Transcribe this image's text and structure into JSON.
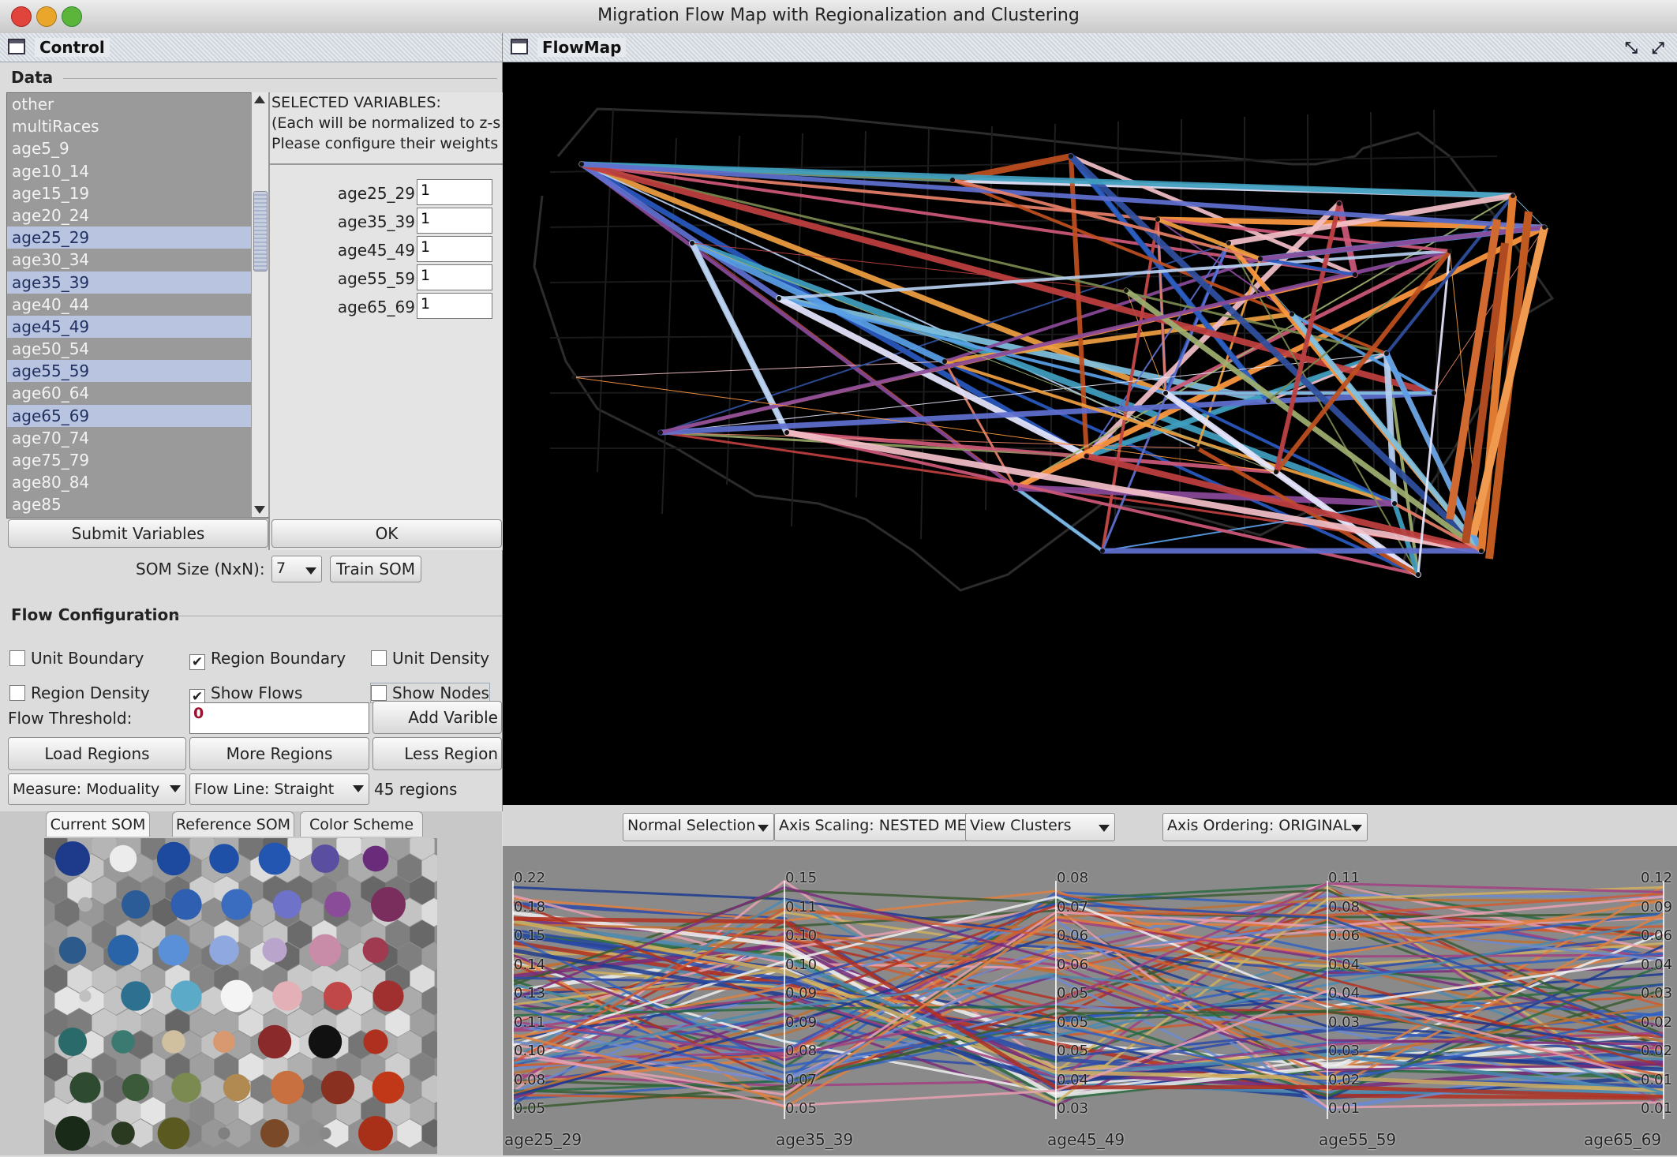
{
  "window": {
    "title": "Migration Flow Map with Regionalization and Clustering"
  },
  "control": {
    "title": "Control",
    "data_group": "Data",
    "variables": [
      {
        "label": "other",
        "selected": false
      },
      {
        "label": "multiRaces",
        "selected": false
      },
      {
        "label": "age5_9",
        "selected": false
      },
      {
        "label": "age10_14",
        "selected": false
      },
      {
        "label": "age15_19",
        "selected": false
      },
      {
        "label": "age20_24",
        "selected": false
      },
      {
        "label": "age25_29",
        "selected": true
      },
      {
        "label": "age30_34",
        "selected": false
      },
      {
        "label": "age35_39",
        "selected": true
      },
      {
        "label": "age40_44",
        "selected": false
      },
      {
        "label": "age45_49",
        "selected": true
      },
      {
        "label": "age50_54",
        "selected": false
      },
      {
        "label": "age55_59",
        "selected": true
      },
      {
        "label": "age60_64",
        "selected": false
      },
      {
        "label": "age65_69",
        "selected": true
      },
      {
        "label": "age70_74",
        "selected": false
      },
      {
        "label": "age75_79",
        "selected": false
      },
      {
        "label": "age80_84",
        "selected": false
      },
      {
        "label": "age85",
        "selected": false
      }
    ],
    "selected_heading": [
      "SELECTED VARIABLES:",
      "(Each will be normalized to z-s",
      "Please configure their weights"
    ],
    "weights": [
      {
        "name": "age25_29",
        "value": "1"
      },
      {
        "name": "age35_39",
        "value": "1"
      },
      {
        "name": "age45_49",
        "value": "1"
      },
      {
        "name": "age55_59",
        "value": "1"
      },
      {
        "name": "age65_69",
        "value": "1"
      }
    ],
    "submit_button": "Submit Variables",
    "ok_button": "OK",
    "som_size_label": "SOM Size (NxN):",
    "som_size_value": "7",
    "train_button": "Train SOM",
    "flow_group": "Flow Configuration",
    "checkboxes": [
      {
        "label": "Unit Boundary",
        "checked": false
      },
      {
        "label": "Region Boundary",
        "checked": true
      },
      {
        "label": "Unit Density",
        "checked": false
      },
      {
        "label": "Region Density",
        "checked": false
      },
      {
        "label": "Show Flows",
        "checked": true
      },
      {
        "label": "Show Nodes",
        "checked": false
      }
    ],
    "flow_threshold_label": "Flow Threshold:",
    "flow_threshold_value": "0",
    "add_variable_button": "Add Varible",
    "load_regions_button": "Load Regions",
    "more_regions_button": "More Regions",
    "less_regions_button": "Less Region",
    "measure_combo": "Measure: Moduality",
    "flowline_combo": "Flow Line: Straight",
    "region_count": "45 regions"
  },
  "flowmap": {
    "title": "FlowMap"
  },
  "som": {
    "tabs": [
      "Current SOM",
      "Reference SOM",
      "Color Scheme"
    ],
    "rows": [
      [
        "#1e3a8a",
        "#ececec",
        "#1d4a9e",
        "#1f50a8",
        "#2356b0",
        "#5a4ea0",
        "#6a2c7a"
      ],
      [
        "#b0b0b0",
        "#2b5c98",
        "#2f5fb0",
        "#3a6cc0",
        "#6e72c8",
        "#8a4c98",
        "#7a2e5e"
      ],
      [
        "#2c5a8a",
        "#2a64a8",
        "#5a90d8",
        "#90a8e0",
        "#b9a4cc",
        "#c88ca8",
        "#a03a50"
      ],
      [
        "#c0c0c0",
        "#2e7090",
        "#5aaac8",
        "#f4f4f4",
        "#e4b0b8",
        "#c04848",
        "#a03030"
      ],
      [
        "#2a6a6a",
        "#3a7a70",
        "#d0c0a0",
        "#d89870",
        "#8a2a2a",
        "#111111",
        "#b03020"
      ],
      [
        "#2e4a30",
        "#3a5a3a",
        "#7a8a50",
        "#b08a50",
        "#c87040",
        "#8a3020",
        "#c03818"
      ],
      [
        "#1a2a18",
        "#2a3a20",
        "#5a5a20",
        "#808080",
        "#7a4a28",
        "#888888",
        "#a83018"
      ]
    ],
    "sizes": [
      [
        1.0,
        0.7,
        0.95,
        0.8,
        0.9,
        0.75,
        0.65
      ],
      [
        0.2,
        0.75,
        0.85,
        0.85,
        0.75,
        0.65,
        1.0
      ],
      [
        0.7,
        0.85,
        0.85,
        0.8,
        0.6,
        0.9,
        0.65
      ],
      [
        0.1,
        0.8,
        0.85,
        0.9,
        0.8,
        0.75,
        0.85
      ],
      [
        0.75,
        0.55,
        0.55,
        0.5,
        0.95,
        0.95,
        0.6
      ],
      [
        0.85,
        0.7,
        0.8,
        0.7,
        0.95,
        0.95,
        0.9
      ],
      [
        1.0,
        0.55,
        0.9,
        0.1,
        0.75,
        0.1,
        1.0
      ]
    ]
  },
  "pcp": {
    "combos": [
      "Normal Selection",
      "Axis Scaling: NESTED MEANS",
      "View Clusters",
      "Axis Ordering: ORIGINAL"
    ],
    "axes": [
      {
        "name": "age25_29",
        "ticks": [
          "0.22",
          "0.18",
          "0.15",
          "0.14",
          "0.13",
          "0.11",
          "0.10",
          "0.08",
          "0.05"
        ]
      },
      {
        "name": "age35_39",
        "ticks": [
          "0.15",
          "0.11",
          "0.10",
          "0.10",
          "0.09",
          "0.09",
          "0.08",
          "0.07",
          "0.05"
        ]
      },
      {
        "name": "age45_49",
        "ticks": [
          "0.08",
          "0.07",
          "0.06",
          "0.06",
          "0.05",
          "0.05",
          "0.05",
          "0.04",
          "0.03"
        ]
      },
      {
        "name": "age55_59",
        "ticks": [
          "0.11",
          "0.08",
          "0.06",
          "0.04",
          "0.04",
          "0.03",
          "0.03",
          "0.02",
          "0.01"
        ]
      },
      {
        "name": "age65_69",
        "ticks": [
          "0.12",
          "0.09",
          "0.06",
          "0.04",
          "0.03",
          "0.02",
          "0.02",
          "0.01",
          "0.01"
        ]
      }
    ]
  }
}
